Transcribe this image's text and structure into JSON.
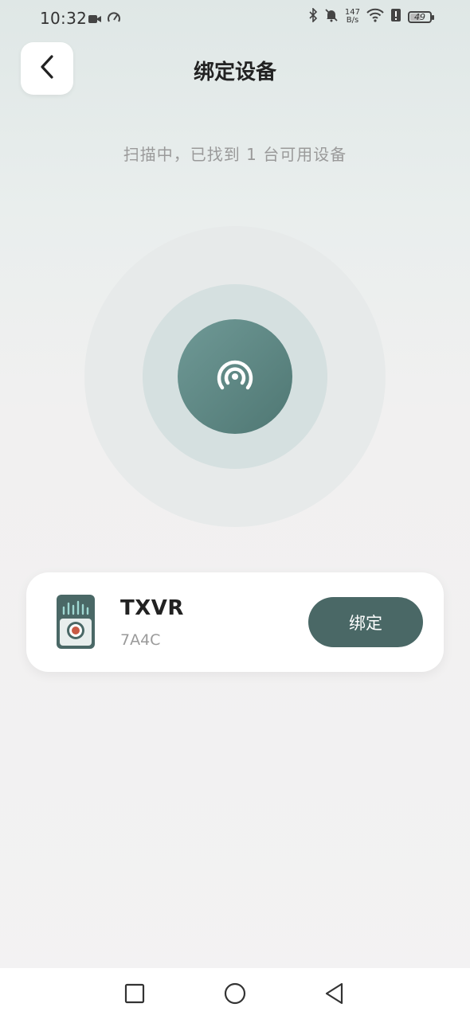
{
  "status_bar": {
    "time": "10:32",
    "net_speed_value": "147",
    "net_speed_unit": "B/s",
    "battery": "49",
    "battery_level": 0.49,
    "icons": [
      "video-icon",
      "speed-icon",
      "bluetooth-icon",
      "mute-bell-icon",
      "wifi-icon",
      "alert-icon",
      "battery-icon"
    ]
  },
  "header": {
    "title": "绑定设备",
    "back_icon": "chevron-left-icon"
  },
  "scan": {
    "status_text": "扫描中，已找到 1 台可用设备",
    "icon": "broadcast-icon"
  },
  "device": {
    "name": "TXVR",
    "id": "7A4C",
    "icon": "recorder-device-icon",
    "bind_label": "绑定"
  },
  "nav": {
    "items": [
      "recent-apps-icon",
      "home-icon",
      "back-icon"
    ]
  },
  "colors": {
    "accent": "#4a6866",
    "radar_core": "#5f8783",
    "record_dot": "#c85a45"
  }
}
